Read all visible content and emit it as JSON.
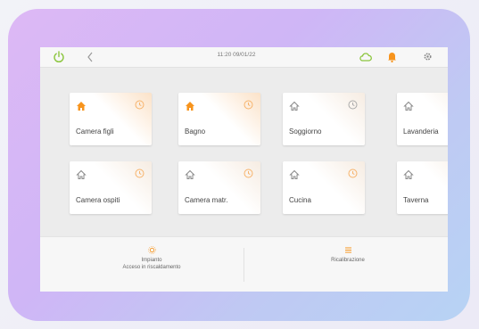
{
  "topbar": {
    "datetime": "11:20 09/01/22",
    "icons": [
      "power-icon",
      "back-icon",
      "cloud-icon",
      "bell-icon",
      "gear-icon"
    ],
    "colors": {
      "power": "#8cc63f",
      "cloud": "#8cc63f",
      "bell": "#f7941d",
      "gear": "#888888"
    }
  },
  "rooms": [
    {
      "name": "Camera figli",
      "active": true
    },
    {
      "name": "Bagno",
      "active": true
    },
    {
      "name": "Soggiorno",
      "active": false
    },
    {
      "name": "Lavanderia",
      "active": false
    },
    {
      "name": "Camera ospiti",
      "active": false
    },
    {
      "name": "Camera matr.",
      "active": false
    },
    {
      "name": "Cucina",
      "active": false
    },
    {
      "name": "Taverna",
      "active": false
    }
  ],
  "bottom": {
    "impianto_label": "Impianto",
    "impianto_sublabel": "Acceso in riscaldamento",
    "ricalibrazione_label": "Ricalibrazione"
  },
  "colors": {
    "accent": "#f7941d",
    "inactive_icon": "#8a8a8a"
  }
}
